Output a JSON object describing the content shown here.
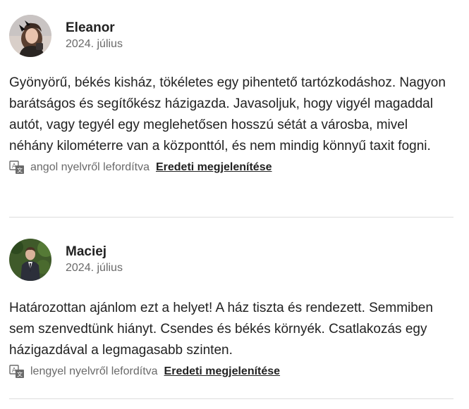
{
  "reviews": [
    {
      "name": "Eleanor",
      "date": "2024. július",
      "text": "Gyönyörű, békés kisház, tökéletes egy pihentető tartózkodáshoz. Nagyon barátságos és segítőkész házigazda. Javasoljuk, hogy vigyél magaddal autót, vagy tegyél egy meglehetősen hosszú sétát a városba, mivel néhány kilométerre van a központtól, és nem mindig könnyű taxit fogni.",
      "translation_note": "angol nyelvről lefordítva",
      "show_original_label": "Eredeti megjelenítése",
      "avatar_icon": "user-photo-eleanor"
    },
    {
      "name": "Maciej",
      "date": "2024. július",
      "text": "Határozottan ajánlom ezt a helyet! A ház tiszta és rendezett. Semmiben sem szenvedtünk hiányt. Csendes és békés környék. Csatlakozás egy házigazdával a legmagasabb szinten.",
      "translation_note": "lengyel nyelvről lefordítva",
      "show_original_label": "Eredeti megjelenítése",
      "avatar_icon": "user-photo-maciej"
    }
  ],
  "icons": {
    "translate": "translate-icon"
  },
  "colors": {
    "text_primary": "#222222",
    "text_secondary": "#6a6a6a",
    "divider": "#dddddd"
  }
}
